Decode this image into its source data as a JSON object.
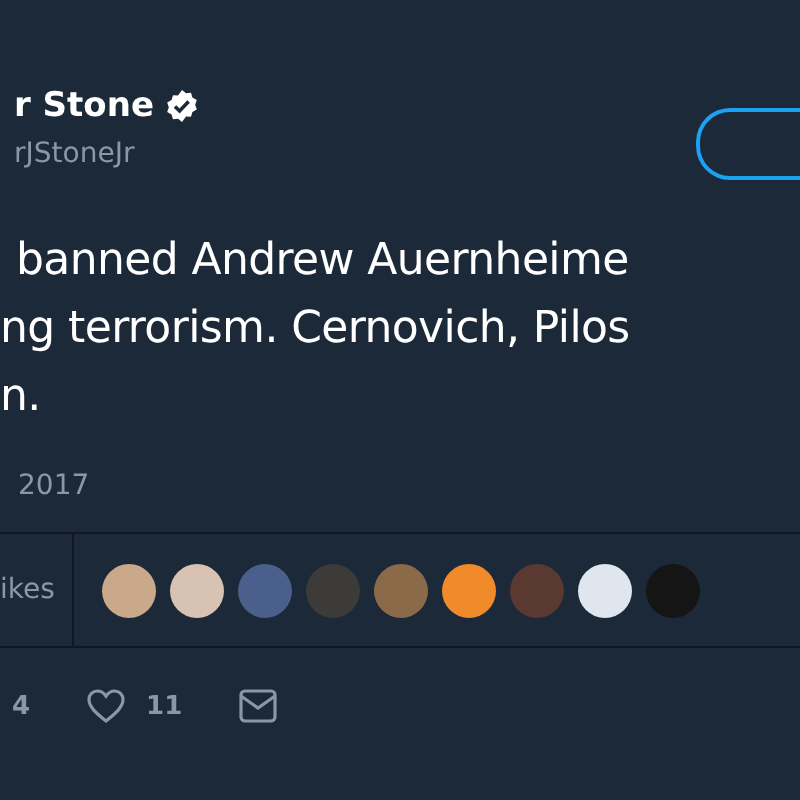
{
  "tweet": {
    "author_name": "r Stone",
    "verified": true,
    "handle": "rJStoneJr",
    "text_lines": [
      "banned Andrew Auernheime",
      "ng terrorism. Cernovich, Pilos",
      "n."
    ],
    "date": "2017"
  },
  "stats": {
    "likes_label": "ikes",
    "likers": [
      {
        "color": "#c9a98a"
      },
      {
        "color": "#d8c2b4"
      },
      {
        "color": "#4a5f8c"
      },
      {
        "color": "#3d3a3a"
      },
      {
        "color": "#8a6a48"
      },
      {
        "color": "#f08a2a"
      },
      {
        "color": "#5a3a30"
      },
      {
        "color": "#e0e6ee"
      },
      {
        "color": "#151515"
      }
    ]
  },
  "actions": [
    {
      "kind": "retweet",
      "count": "4"
    },
    {
      "kind": "like",
      "count": "11"
    },
    {
      "kind": "message"
    }
  ]
}
